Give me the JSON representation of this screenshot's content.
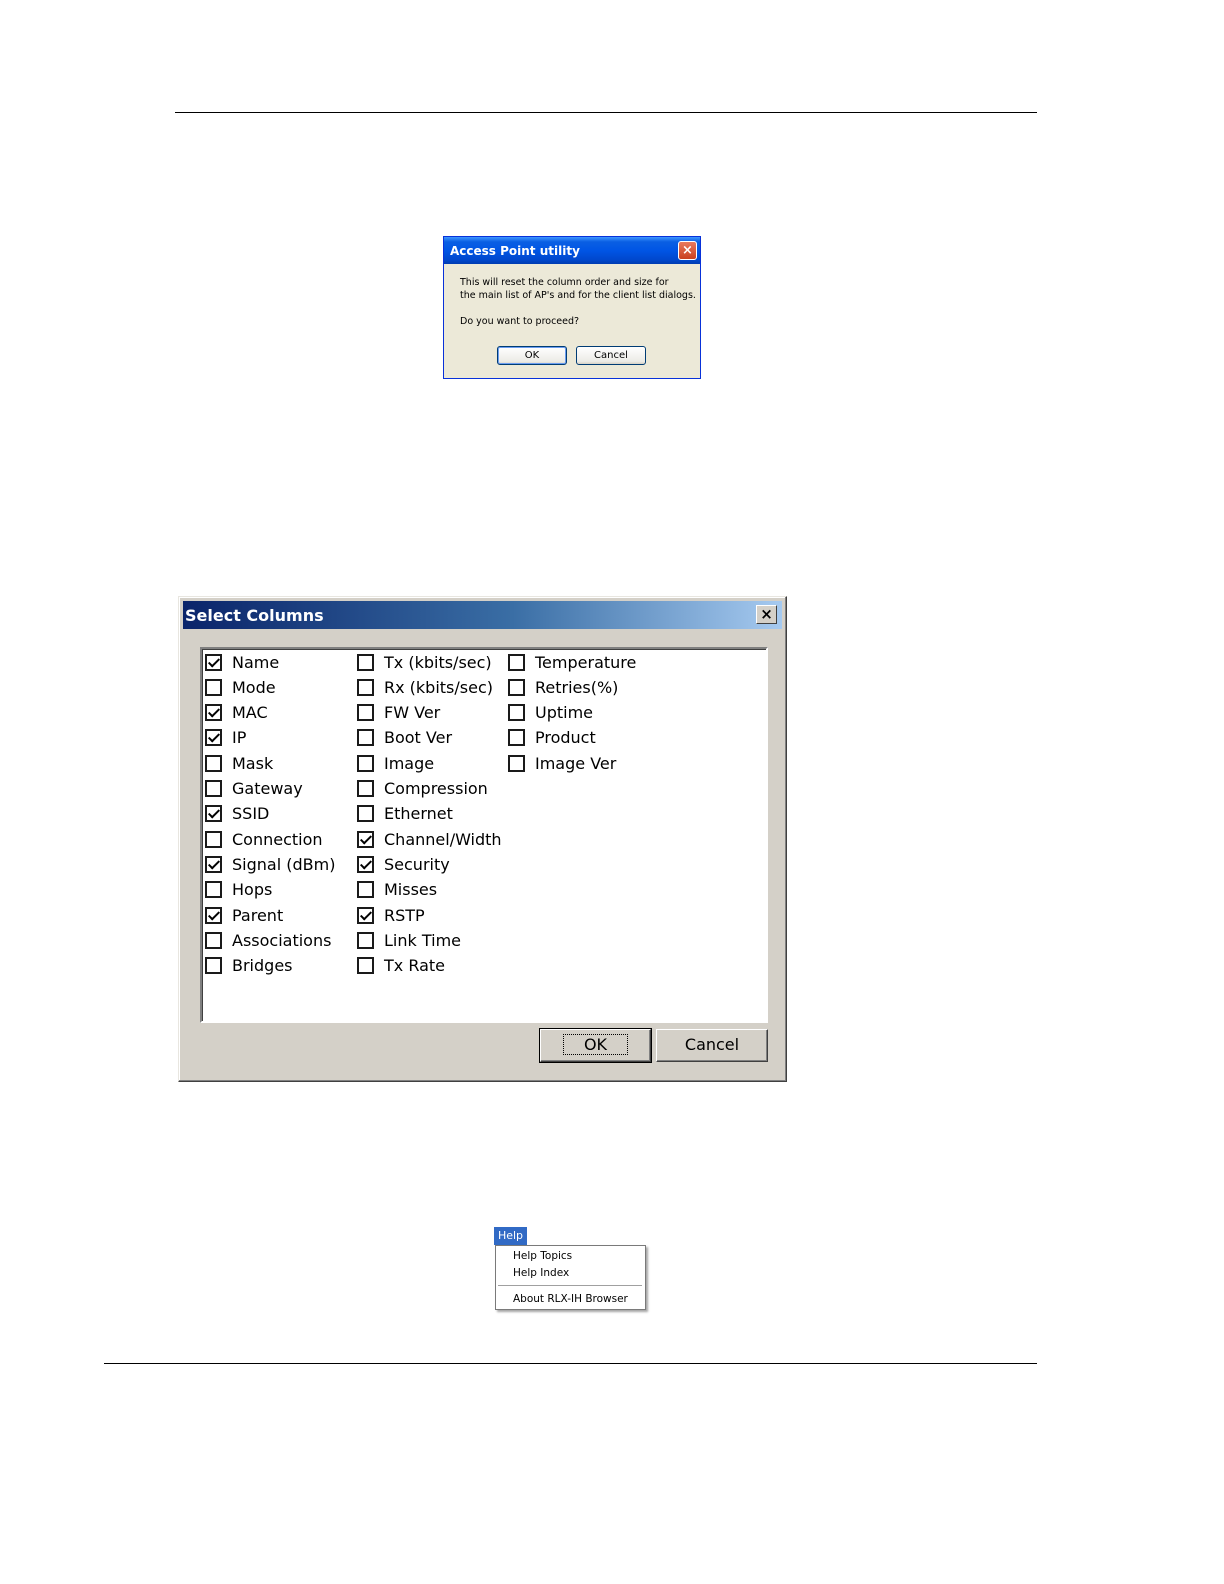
{
  "ap_dialog": {
    "title": "Access Point utility",
    "close": "×",
    "message_line1": "This will reset the column order and size for",
    "message_line2": "the main list of AP's and for the client list dialogs.",
    "question": "Do you want to proceed?",
    "ok_label": "OK",
    "cancel_label": "Cancel"
  },
  "select_columns": {
    "title": "Select Columns",
    "close": "×",
    "columns": [
      [
        {
          "label": "Name",
          "checked": true
        },
        {
          "label": "Mode",
          "checked": false
        },
        {
          "label": "MAC",
          "checked": true
        },
        {
          "label": "IP",
          "checked": true
        },
        {
          "label": "Mask",
          "checked": false
        },
        {
          "label": "Gateway",
          "checked": false
        },
        {
          "label": "SSID",
          "checked": true
        },
        {
          "label": "Connection",
          "checked": false
        },
        {
          "label": "Signal (dBm)",
          "checked": true
        },
        {
          "label": "Hops",
          "checked": false
        },
        {
          "label": "Parent",
          "checked": true
        },
        {
          "label": "Associations",
          "checked": false
        },
        {
          "label": "Bridges",
          "checked": false
        }
      ],
      [
        {
          "label": "Tx (kbits/sec)",
          "checked": false
        },
        {
          "label": "Rx (kbits/sec)",
          "checked": false
        },
        {
          "label": "FW Ver",
          "checked": false
        },
        {
          "label": "Boot Ver",
          "checked": false
        },
        {
          "label": "Image",
          "checked": false
        },
        {
          "label": "Compression",
          "checked": false
        },
        {
          "label": "Ethernet",
          "checked": false
        },
        {
          "label": "Channel/Width",
          "checked": true
        },
        {
          "label": "Security",
          "checked": true
        },
        {
          "label": "Misses",
          "checked": false
        },
        {
          "label": "RSTP",
          "checked": true
        },
        {
          "label": "Link Time",
          "checked": false
        },
        {
          "label": "Tx Rate",
          "checked": false
        }
      ],
      [
        {
          "label": "Temperature",
          "checked": false
        },
        {
          "label": "Retries(%)",
          "checked": false
        },
        {
          "label": "Uptime",
          "checked": false
        },
        {
          "label": "Product",
          "checked": false
        },
        {
          "label": "Image Ver",
          "checked": false
        }
      ]
    ],
    "ok_label": "OK",
    "cancel_label": "Cancel"
  },
  "help_menu": {
    "title": "Help",
    "items": [
      "Help Topics",
      "Help Index",
      "About RLX-IH Browser"
    ]
  }
}
